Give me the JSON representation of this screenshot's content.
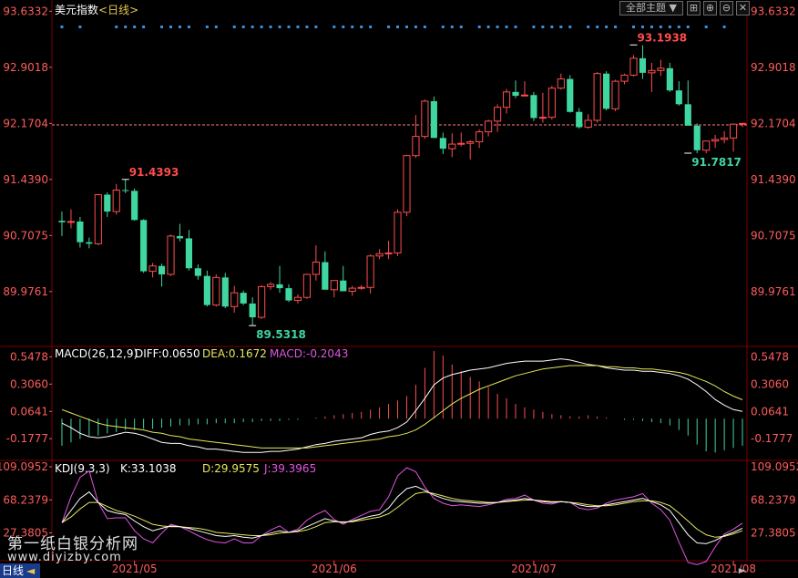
{
  "header": {
    "title": "美元指数",
    "period": "<日线>",
    "main_chart_select": "全部主题",
    "select_arrow": "▼"
  },
  "watermark": {
    "line1": "第一纸白银分析网",
    "line2": "www.diyizby.com"
  },
  "bottom_bar": {
    "period_tab": "日线",
    "left_arrow": "◄",
    "scroll_arrow": "►"
  },
  "colors": {
    "up": "#ff4d4d",
    "down": "#3fd6a0",
    "axis_text": "#ff5c5c",
    "grid": "#7a0000",
    "last_price_line": "#ff7f7f",
    "macd_line": "#ffffff",
    "dea_line": "#e6e65c",
    "kdj_k": "#ffffff",
    "kdj_d": "#e6e65c",
    "kdj_j": "#e055e0",
    "signal_dots": "#3a8fe0"
  },
  "chart_data": [
    {
      "type": "candlestick",
      "title": "美元指数<日线>",
      "y_ticks": [
        "93.6332",
        "92.9018",
        "92.1704",
        "91.4390",
        "90.7075",
        "89.9761"
      ],
      "ylim": [
        89.26,
        93.78
      ],
      "x_ticks": [
        "2021/05",
        "2021/06",
        "2021/07",
        "2021/08"
      ],
      "x_tick_index": [
        8,
        30,
        52,
        74
      ],
      "annotations": [
        {
          "text": "91.4393",
          "index": 7,
          "value": 91.4393,
          "kind": "high"
        },
        {
          "text": "89.5318",
          "index": 21,
          "value": 89.5318,
          "kind": "low"
        },
        {
          "text": "93.1938",
          "index": 63,
          "value": 93.1938,
          "kind": "high"
        },
        {
          "text": "91.7817",
          "index": 69,
          "value": 91.7817,
          "kind": "low"
        }
      ],
      "last_price": 92.15,
      "signal_dot_indices": [
        0,
        2,
        6,
        7,
        8,
        9,
        11,
        12,
        13,
        14,
        16,
        17,
        19,
        20,
        21,
        22,
        23,
        24,
        25,
        26,
        27,
        28,
        30,
        31,
        32,
        33,
        34,
        36,
        37,
        38,
        39,
        40,
        42,
        43,
        44,
        46,
        47,
        48,
        49,
        50,
        52,
        53,
        54,
        55,
        56,
        58,
        59,
        60,
        61,
        63,
        64,
        65,
        66,
        67,
        68,
        69,
        71,
        73
      ],
      "candles": [
        {
          "o": 90.9,
          "h": 91.02,
          "l": 90.7,
          "c": 90.88
        },
        {
          "o": 90.88,
          "h": 91.05,
          "l": 90.8,
          "c": 90.89
        },
        {
          "o": 90.89,
          "h": 90.95,
          "l": 90.55,
          "c": 90.62
        },
        {
          "o": 90.62,
          "h": 90.68,
          "l": 90.54,
          "c": 90.6
        },
        {
          "o": 90.6,
          "h": 91.25,
          "l": 90.58,
          "c": 91.24
        },
        {
          "o": 91.24,
          "h": 91.27,
          "l": 90.95,
          "c": 91.02
        },
        {
          "o": 91.02,
          "h": 91.38,
          "l": 90.98,
          "c": 91.3
        },
        {
          "o": 91.3,
          "h": 91.44,
          "l": 91.26,
          "c": 91.29
        },
        {
          "o": 91.29,
          "h": 91.32,
          "l": 90.9,
          "c": 90.91
        },
        {
          "o": 90.91,
          "h": 90.92,
          "l": 90.22,
          "c": 90.24
        },
        {
          "o": 90.24,
          "h": 90.35,
          "l": 90.16,
          "c": 90.31
        },
        {
          "o": 90.31,
          "h": 90.34,
          "l": 90.04,
          "c": 90.2
        },
        {
          "o": 90.2,
          "h": 90.72,
          "l": 90.18,
          "c": 90.7
        },
        {
          "o": 90.7,
          "h": 90.86,
          "l": 90.63,
          "c": 90.67
        },
        {
          "o": 90.67,
          "h": 90.78,
          "l": 90.25,
          "c": 90.28
        },
        {
          "o": 90.28,
          "h": 90.33,
          "l": 90.13,
          "c": 90.18
        },
        {
          "o": 90.18,
          "h": 90.25,
          "l": 89.78,
          "c": 89.8
        },
        {
          "o": 89.8,
          "h": 90.2,
          "l": 89.78,
          "c": 90.16
        },
        {
          "o": 90.16,
          "h": 90.22,
          "l": 89.76,
          "c": 89.78
        },
        {
          "o": 89.78,
          "h": 90.05,
          "l": 89.7,
          "c": 89.96
        },
        {
          "o": 89.96,
          "h": 89.99,
          "l": 89.8,
          "c": 89.82
        },
        {
          "o": 89.82,
          "h": 89.9,
          "l": 89.53,
          "c": 89.64
        },
        {
          "o": 89.64,
          "h": 90.06,
          "l": 89.62,
          "c": 90.04
        },
        {
          "o": 90.04,
          "h": 90.1,
          "l": 90.0,
          "c": 90.07
        },
        {
          "o": 90.07,
          "h": 90.31,
          "l": 89.96,
          "c": 90.02
        },
        {
          "o": 90.02,
          "h": 90.07,
          "l": 89.84,
          "c": 89.86
        },
        {
          "o": 89.86,
          "h": 89.94,
          "l": 89.82,
          "c": 89.9
        },
        {
          "o": 89.9,
          "h": 90.21,
          "l": 89.88,
          "c": 90.2
        },
        {
          "o": 90.2,
          "h": 90.58,
          "l": 90.12,
          "c": 90.36
        },
        {
          "o": 90.36,
          "h": 90.5,
          "l": 90.1,
          "c": 90.0
        },
        {
          "o": 90.0,
          "h": 90.08,
          "l": 89.9,
          "c": 90.12
        },
        {
          "o": 90.12,
          "h": 90.31,
          "l": 90.06,
          "c": 89.98
        },
        {
          "o": 89.98,
          "h": 90.05,
          "l": 89.92,
          "c": 90.02
        },
        {
          "o": 90.02,
          "h": 90.06,
          "l": 90.0,
          "c": 90.03
        },
        {
          "o": 90.03,
          "h": 90.46,
          "l": 89.95,
          "c": 90.44
        },
        {
          "o": 90.44,
          "h": 90.53,
          "l": 90.4,
          "c": 90.47
        },
        {
          "o": 90.47,
          "h": 90.64,
          "l": 90.4,
          "c": 90.48
        },
        {
          "o": 90.48,
          "h": 91.05,
          "l": 90.44,
          "c": 91.01
        },
        {
          "o": 91.01,
          "h": 91.76,
          "l": 90.96,
          "c": 91.75
        },
        {
          "o": 91.75,
          "h": 92.28,
          "l": 91.72,
          "c": 92.0
        },
        {
          "o": 92.0,
          "h": 92.48,
          "l": 91.97,
          "c": 92.46
        },
        {
          "o": 92.46,
          "h": 92.52,
          "l": 91.98,
          "c": 91.98
        },
        {
          "o": 91.98,
          "h": 92.05,
          "l": 91.77,
          "c": 91.84
        },
        {
          "o": 91.84,
          "h": 92.04,
          "l": 91.73,
          "c": 91.9
        },
        {
          "o": 91.9,
          "h": 92.05,
          "l": 91.87,
          "c": 91.91
        },
        {
          "o": 91.91,
          "h": 91.95,
          "l": 91.7,
          "c": 91.93
        },
        {
          "o": 91.93,
          "h": 92.09,
          "l": 91.85,
          "c": 92.06
        },
        {
          "o": 92.06,
          "h": 92.22,
          "l": 92.0,
          "c": 92.2
        },
        {
          "o": 92.2,
          "h": 92.42,
          "l": 92.06,
          "c": 92.38
        },
        {
          "o": 92.38,
          "h": 92.62,
          "l": 92.3,
          "c": 92.58
        },
        {
          "o": 92.58,
          "h": 92.73,
          "l": 92.5,
          "c": 92.53
        },
        {
          "o": 92.53,
          "h": 92.72,
          "l": 92.52,
          "c": 92.54
        },
        {
          "o": 92.54,
          "h": 92.58,
          "l": 92.2,
          "c": 92.24
        },
        {
          "o": 92.24,
          "h": 92.57,
          "l": 92.18,
          "c": 92.25
        },
        {
          "o": 92.25,
          "h": 92.66,
          "l": 92.22,
          "c": 92.63
        },
        {
          "o": 92.63,
          "h": 92.82,
          "l": 92.61,
          "c": 92.75
        },
        {
          "o": 92.75,
          "h": 92.8,
          "l": 92.31,
          "c": 92.32
        },
        {
          "o": 92.32,
          "h": 92.37,
          "l": 92.1,
          "c": 92.12
        },
        {
          "o": 92.12,
          "h": 92.29,
          "l": 92.1,
          "c": 92.21
        },
        {
          "o": 92.21,
          "h": 92.84,
          "l": 92.18,
          "c": 92.82
        },
        {
          "o": 92.82,
          "h": 92.85,
          "l": 92.34,
          "c": 92.36
        },
        {
          "o": 92.36,
          "h": 92.74,
          "l": 92.33,
          "c": 92.72
        },
        {
          "o": 92.72,
          "h": 92.82,
          "l": 92.68,
          "c": 92.8
        },
        {
          "o": 92.8,
          "h": 93.06,
          "l": 92.78,
          "c": 93.02
        },
        {
          "o": 93.02,
          "h": 93.19,
          "l": 92.75,
          "c": 92.83
        },
        {
          "o": 92.83,
          "h": 92.96,
          "l": 92.58,
          "c": 92.86
        },
        {
          "o": 92.86,
          "h": 93.0,
          "l": 92.79,
          "c": 92.89
        },
        {
          "o": 92.89,
          "h": 92.96,
          "l": 92.58,
          "c": 92.6
        },
        {
          "o": 92.6,
          "h": 92.72,
          "l": 92.4,
          "c": 92.42
        },
        {
          "o": 92.42,
          "h": 92.73,
          "l": 92.36,
          "c": 92.14
        },
        {
          "o": 92.14,
          "h": 92.17,
          "l": 91.78,
          "c": 91.82
        },
        {
          "o": 91.82,
          "h": 91.9,
          "l": 91.78,
          "c": 91.94
        },
        {
          "o": 91.94,
          "h": 92.02,
          "l": 91.85,
          "c": 91.96
        },
        {
          "o": 91.96,
          "h": 92.07,
          "l": 91.91,
          "c": 91.98
        },
        {
          "o": 91.98,
          "h": 92.17,
          "l": 91.8,
          "c": 92.16
        },
        {
          "o": 92.16,
          "h": 92.18,
          "l": 92.12,
          "c": 92.17
        }
      ]
    },
    {
      "type": "bar",
      "title": "MACD(26,12,9)",
      "legend": {
        "diff_label": "DIFF:0.0650",
        "dea_label": "DEA:0.1672",
        "macd_label": "MACD:-0.2043"
      },
      "y_ticks": [
        "0.5478",
        "0.3060",
        "0.0641",
        "-0.1777"
      ],
      "ylim": [
        -0.37,
        0.64
      ],
      "hist": [
        -0.24,
        -0.21,
        -0.18,
        -0.15,
        -0.15,
        -0.13,
        -0.12,
        -0.1,
        -0.1,
        -0.09,
        -0.09,
        -0.08,
        -0.07,
        -0.06,
        -0.06,
        -0.05,
        -0.05,
        -0.04,
        -0.04,
        -0.04,
        -0.03,
        -0.03,
        -0.02,
        -0.02,
        -0.02,
        -0.01,
        -0.01,
        0.0,
        0.01,
        0.02,
        0.03,
        0.04,
        0.05,
        0.06,
        0.08,
        0.1,
        0.13,
        0.16,
        0.2,
        0.3,
        0.45,
        0.6,
        0.56,
        0.48,
        0.42,
        0.37,
        0.33,
        0.28,
        0.22,
        0.18,
        0.13,
        0.1,
        0.08,
        0.06,
        0.04,
        0.03,
        0.02,
        0.02,
        0.03,
        0.02,
        0.01,
        0.0,
        -0.01,
        -0.01,
        -0.02,
        -0.03,
        -0.04,
        -0.06,
        -0.1,
        -0.15,
        -0.23,
        -0.29,
        -0.3,
        -0.28,
        -0.26,
        -0.24
      ],
      "diff": [
        -0.04,
        -0.08,
        -0.13,
        -0.16,
        -0.17,
        -0.16,
        -0.14,
        -0.12,
        -0.13,
        -0.15,
        -0.18,
        -0.21,
        -0.22,
        -0.22,
        -0.24,
        -0.25,
        -0.27,
        -0.27,
        -0.28,
        -0.29,
        -0.3,
        -0.3,
        -0.3,
        -0.29,
        -0.29,
        -0.28,
        -0.27,
        -0.25,
        -0.23,
        -0.22,
        -0.2,
        -0.19,
        -0.18,
        -0.17,
        -0.14,
        -0.12,
        -0.11,
        -0.08,
        -0.03,
        0.07,
        0.18,
        0.3,
        0.36,
        0.39,
        0.41,
        0.43,
        0.44,
        0.45,
        0.47,
        0.49,
        0.5,
        0.51,
        0.51,
        0.51,
        0.52,
        0.53,
        0.52,
        0.5,
        0.48,
        0.47,
        0.45,
        0.44,
        0.43,
        0.43,
        0.42,
        0.42,
        0.41,
        0.4,
        0.38,
        0.35,
        0.3,
        0.24,
        0.17,
        0.12,
        0.08,
        0.065
      ],
      "dea": [
        0.08,
        0.05,
        0.02,
        -0.01,
        -0.04,
        -0.06,
        -0.07,
        -0.08,
        -0.09,
        -0.1,
        -0.12,
        -0.13,
        -0.15,
        -0.16,
        -0.18,
        -0.19,
        -0.2,
        -0.21,
        -0.22,
        -0.23,
        -0.24,
        -0.25,
        -0.26,
        -0.26,
        -0.26,
        -0.26,
        -0.26,
        -0.26,
        -0.25,
        -0.24,
        -0.23,
        -0.22,
        -0.21,
        -0.2,
        -0.19,
        -0.18,
        -0.16,
        -0.15,
        -0.13,
        -0.1,
        -0.05,
        0.01,
        0.07,
        0.13,
        0.18,
        0.22,
        0.26,
        0.29,
        0.32,
        0.35,
        0.38,
        0.4,
        0.42,
        0.44,
        0.45,
        0.46,
        0.47,
        0.47,
        0.47,
        0.47,
        0.46,
        0.46,
        0.45,
        0.45,
        0.44,
        0.44,
        0.43,
        0.42,
        0.41,
        0.39,
        0.36,
        0.33,
        0.29,
        0.24,
        0.2,
        0.1672
      ]
    },
    {
      "type": "line",
      "title": "KDJ(9,3,3)",
      "legend": {
        "k_label": "K:33.1038",
        "d_label": "D:29.9575",
        "j_label": "J:39.3965"
      },
      "y_ticks": [
        "109.0952",
        "68.2379",
        "27.3805"
      ],
      "ylim": [
        -7,
        117
      ],
      "k": [
        40,
        55,
        70,
        78,
        65,
        55,
        52,
        50,
        42,
        35,
        30,
        33,
        36,
        35,
        33,
        30,
        27,
        24,
        23,
        24,
        22,
        21,
        24,
        27,
        30,
        28,
        30,
        35,
        40,
        45,
        42,
        40,
        42,
        45,
        48,
        50,
        58,
        72,
        82,
        85,
        80,
        74,
        70,
        67,
        66,
        65,
        64,
        64,
        65,
        67,
        68,
        70,
        68,
        66,
        65,
        66,
        65,
        62,
        60,
        60,
        62,
        64,
        66,
        68,
        70,
        66,
        62,
        55,
        40,
        25,
        15,
        14,
        18,
        24,
        28,
        33.1
      ],
      "d": [
        40,
        47,
        57,
        65,
        65,
        60,
        55,
        52,
        48,
        43,
        38,
        36,
        35,
        35,
        34,
        33,
        31,
        28,
        27,
        26,
        25,
        24,
        24,
        25,
        27,
        28,
        29,
        31,
        35,
        40,
        41,
        41,
        41,
        43,
        45,
        47,
        51,
        59,
        68,
        76,
        78,
        76,
        73,
        70,
        68,
        67,
        66,
        65,
        65,
        66,
        67,
        68,
        68,
        67,
        66,
        66,
        65,
        64,
        62,
        61,
        61,
        62,
        64,
        66,
        67,
        67,
        65,
        61,
        52,
        42,
        32,
        25,
        22,
        23,
        26,
        29.96
      ],
      "j": [
        40,
        72,
        96,
        104,
        65,
        45,
        46,
        46,
        30,
        20,
        15,
        27,
        38,
        35,
        30,
        24,
        19,
        16,
        15,
        20,
        15,
        15,
        24,
        31,
        36,
        28,
        32,
        43,
        50,
        55,
        44,
        38,
        44,
        49,
        54,
        56,
        72,
        98,
        108,
        103,
        84,
        70,
        64,
        61,
        62,
        61,
        60,
        62,
        65,
        69,
        70,
        74,
        68,
        64,
        63,
        66,
        65,
        58,
        56,
        58,
        64,
        68,
        70,
        72,
        76,
        64,
        56,
        43,
        16,
        -9,
        -12,
        -8,
        10,
        26,
        32,
        39.4
      ]
    }
  ]
}
